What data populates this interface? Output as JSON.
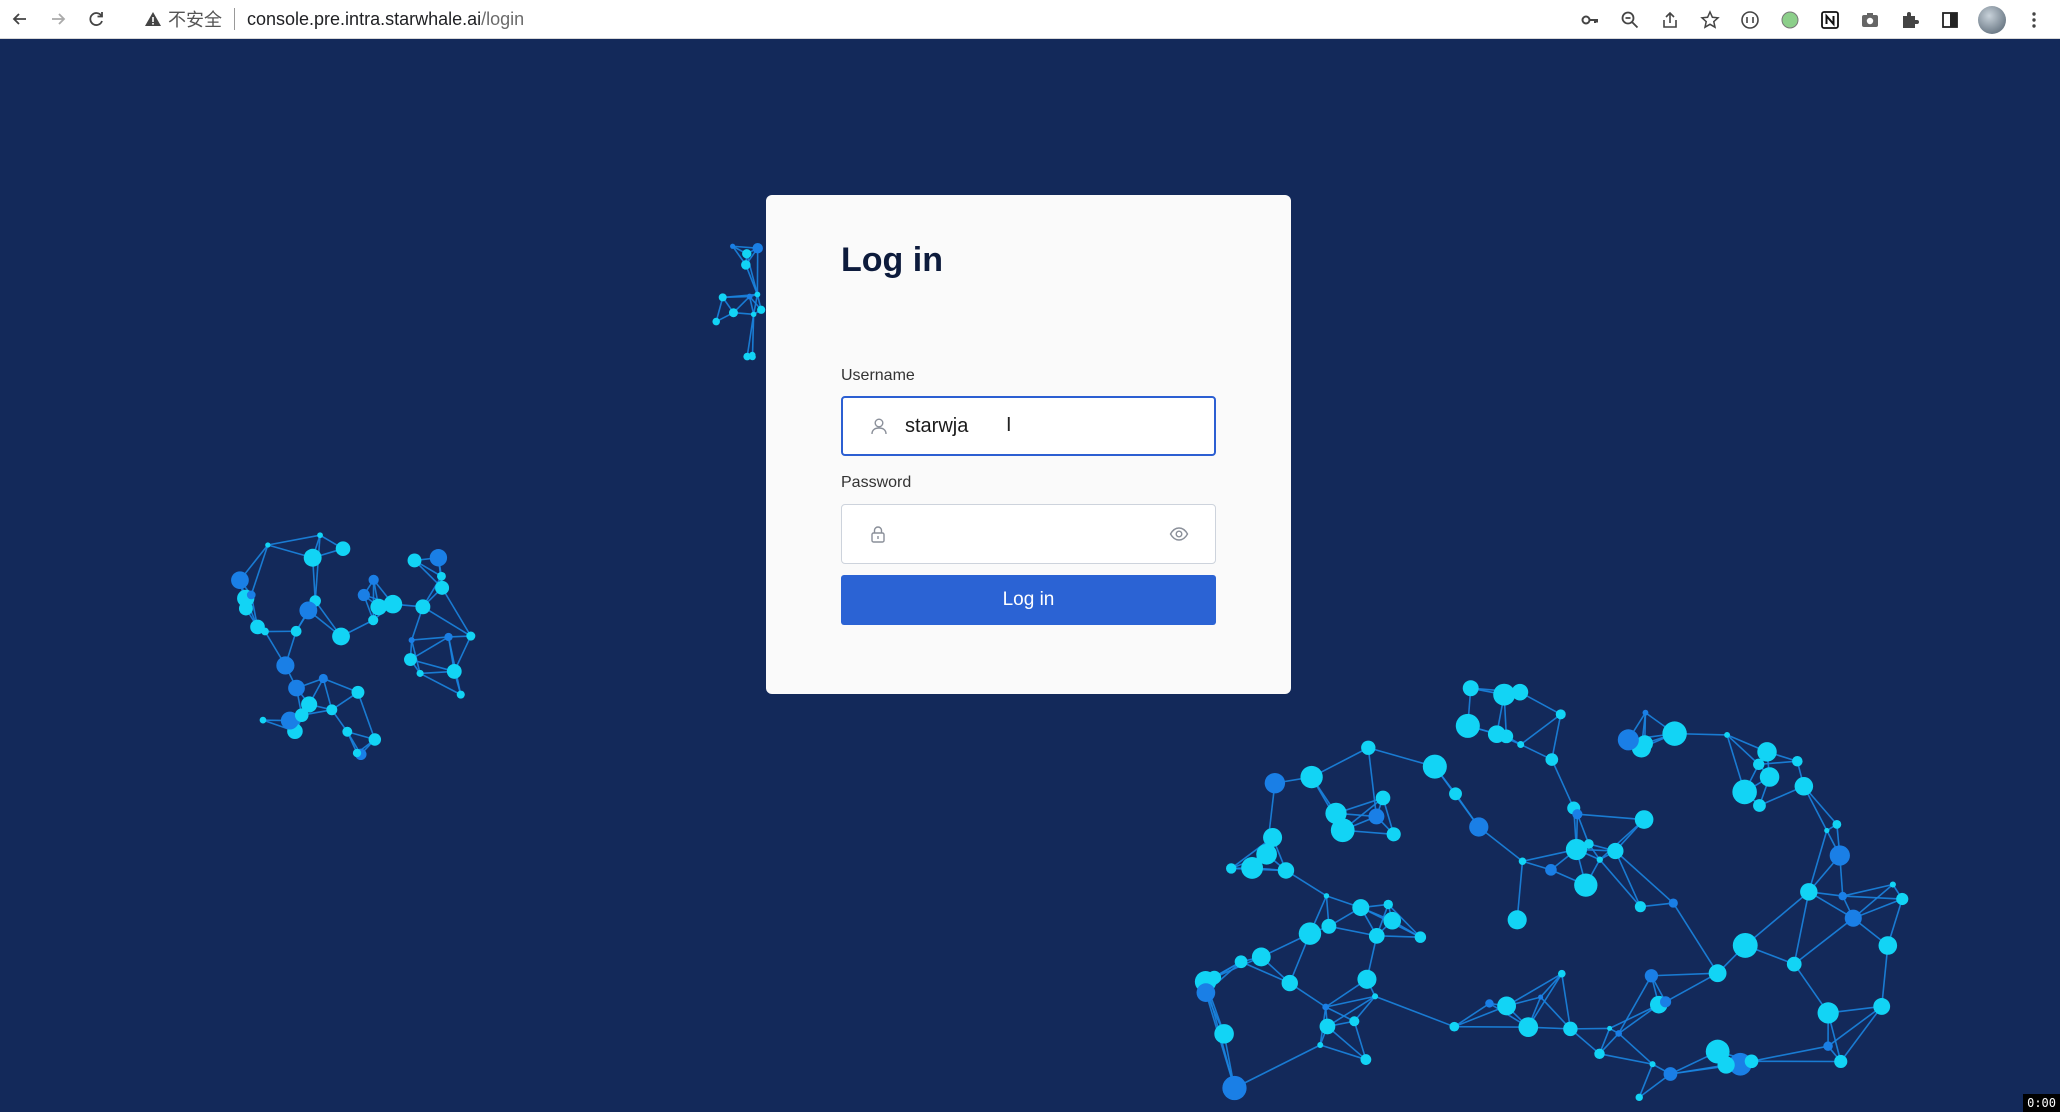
{
  "browser": {
    "security_label": "不安全",
    "url_host": "console.pre.intra.starwhale.ai",
    "url_path": "/login",
    "icons": [
      "back-arrow-icon",
      "forward-arrow-icon",
      "reload-icon",
      "warning-icon",
      "key-icon",
      "zoom-icon",
      "share-icon",
      "star-icon",
      "extension-icon",
      "extension-icon",
      "notion-icon",
      "camera-icon",
      "puzzle-icon",
      "sidebar-icon",
      "avatar",
      "more-icon"
    ]
  },
  "login": {
    "title": "Log in",
    "username_label": "Username",
    "username_value": "starwja",
    "ibeam": "I",
    "password_label": "Password",
    "password_value": "",
    "submit_label": "Log in"
  },
  "recording": {
    "timer": "0:00"
  },
  "colors": {
    "background": "#13295a",
    "accent": "#2b63d4",
    "node": "#12d4f5",
    "edge": "#1a84e0"
  }
}
